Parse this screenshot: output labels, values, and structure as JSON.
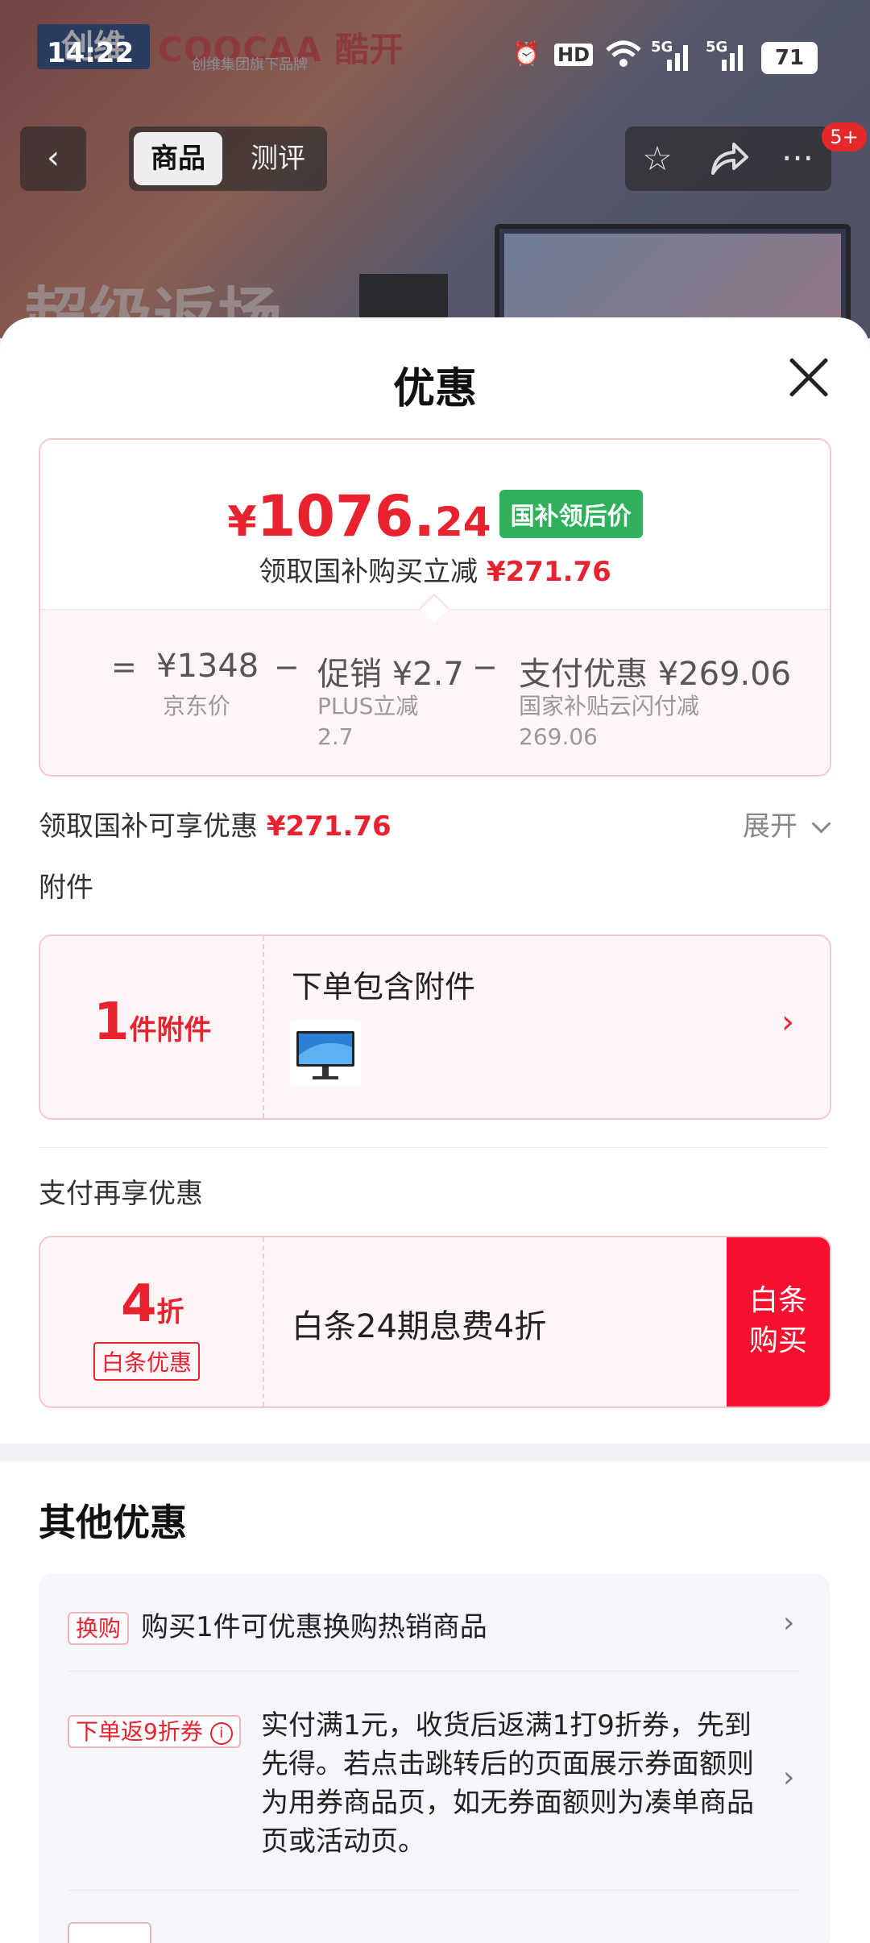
{
  "status_bar": {
    "time": "14:22",
    "hd": "HD",
    "signal1": "5G",
    "signal2": "5G",
    "battery": "71"
  },
  "background": {
    "brand_left": "创维",
    "brand_right": "COOCAA 酷开",
    "brand_sub": "创维集团旗下品牌",
    "promo_text": "超级返场"
  },
  "nav": {
    "back": "‹",
    "tab_goods": "商品",
    "tab_review": "测评",
    "badge": "5+"
  },
  "sheet": {
    "title": "优惠",
    "price": {
      "currency": "¥",
      "integer": "1076.",
      "decimal": "24",
      "tag": "国补领后价",
      "sub_label": "领取国补购买立减",
      "sub_value": "¥271.76"
    },
    "breakdown": {
      "eq": "=",
      "jd_price": "¥1348",
      "jd_label": "京东价",
      "minus1": "−",
      "promo_label": "促销",
      "promo_value": "¥2.7",
      "promo_desc": "PLUS立减",
      "promo_desc_value": "2.7",
      "minus2": "−",
      "pay_label": "支付优惠",
      "pay_value": "¥269.06",
      "pay_desc": "国家补贴云闪付减",
      "pay_desc_value": "269.06"
    },
    "guobu_row": {
      "label": "领取国补可享优惠",
      "value": "¥271.76",
      "expand": "展开"
    },
    "attach": {
      "section": "附件",
      "count": "1",
      "count_unit": "件附件",
      "title": "下单包含附件",
      "arrow": "›"
    },
    "pay": {
      "section": "支付再享优惠",
      "discount": "4",
      "discount_unit": "折",
      "tag": "白条优惠",
      "text": "白条24期息费4折",
      "button_line1": "白条",
      "button_line2": "购买"
    },
    "other": {
      "title": "其他优惠",
      "items": [
        {
          "tag": "换购",
          "text": "购买1件可优惠换购热销商品"
        },
        {
          "tag": "下单返9折券",
          "text": "实付满1元，收货后返满1打9折券，先到先得。若点击跳转后的页面展示券面额则为用券商品页，如无券面额则为凑单商品页或活动页。"
        },
        {
          "tag": "",
          "text": ""
        }
      ]
    }
  }
}
